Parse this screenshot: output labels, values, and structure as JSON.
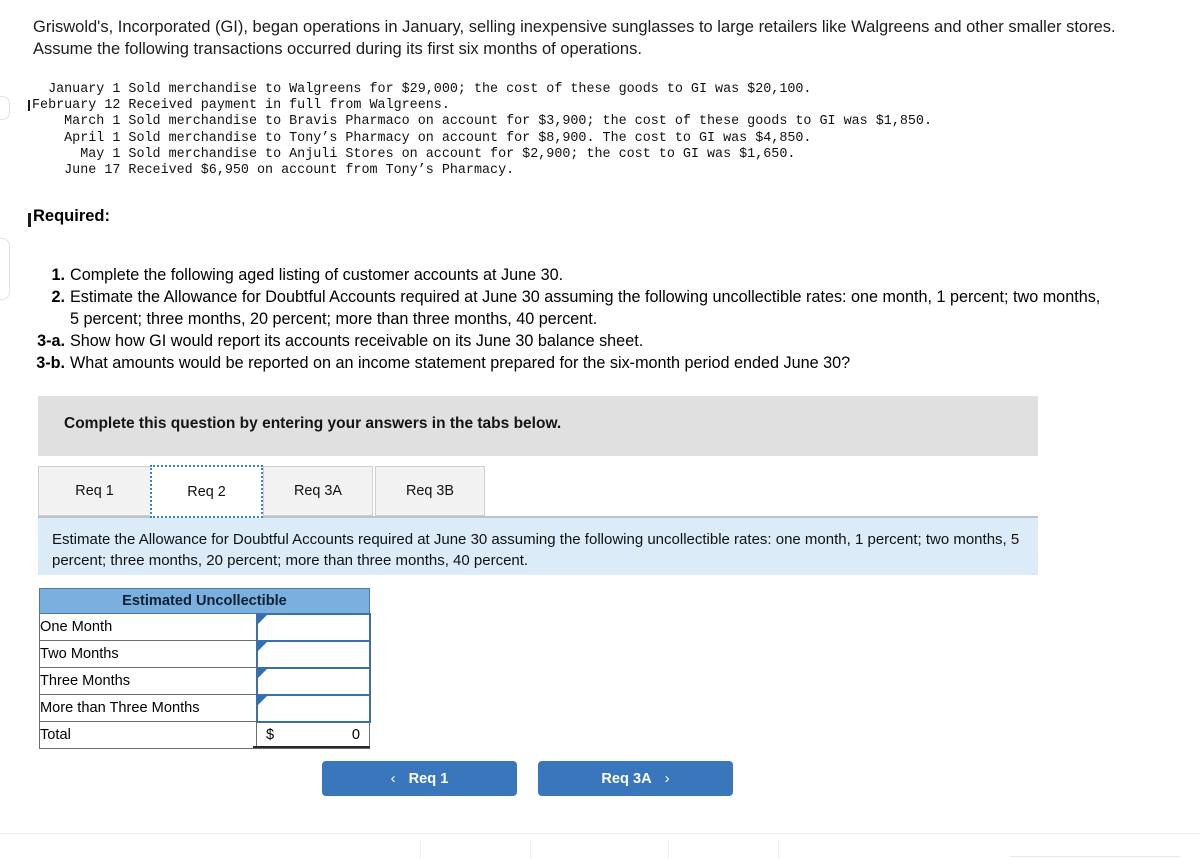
{
  "intro": {
    "paragraph": "Griswold's, Incorporated (GI), began operations in January, selling inexpensive sunglasses to large retailers like Walgreens and other smaller stores. Assume the following transactions occurred during its first six months of operations."
  },
  "transactions": {
    "block": "  January 1 Sold merchandise to Walgreens for $29,000; the cost of these goods to GI was $20,100.\nFebruary 12 Received payment in full from Walgreens.\n    March 1 Sold merchandise to Bravis Pharmaco on account for $3,900; the cost of these goods to GI was $1,850.\n    April 1 Sold merchandise to Tony’s Pharmacy on account for $8,900. The cost to GI was $4,850.\n      May 1 Sold merchandise to Anjuli Stores on account for $2,900; the cost to GI was $1,650.\n    June 17 Received $6,950 on account from Tony’s Pharmacy."
  },
  "required": {
    "heading": "Required:",
    "items": [
      {
        "num": "1.",
        "text": "Complete the following aged listing of customer accounts at June 30."
      },
      {
        "num": "2.",
        "text": "Estimate the Allowance for Doubtful Accounts required at June 30 assuming the following uncollectible rates: one month, 1 percent; two months, 5 percent; three months, 20 percent; more than three months, 40 percent."
      },
      {
        "num": "3-a.",
        "text": "Show how GI would report its accounts receivable on its June 30 balance sheet."
      },
      {
        "num": "3-b.",
        "text": "What amounts would be reported on an income statement prepared for the six-month period ended June 30?"
      }
    ]
  },
  "banner": {
    "text": "Complete this question by entering your answers in the tabs below."
  },
  "tabs": {
    "items": [
      {
        "label": "Req 1",
        "active": false
      },
      {
        "label": "Req 2",
        "active": true
      },
      {
        "label": "Req 3A",
        "active": false
      },
      {
        "label": "Req 3B",
        "active": false
      }
    ]
  },
  "instruction_panel": {
    "text": "Estimate the Allowance for Doubtful Accounts required at June 30 assuming the following uncollectible rates: one month, 1 percent; two months, 5 percent; three months, 20 percent; more than three months, 40 percent."
  },
  "answer_table": {
    "header": "Estimated Uncollectible",
    "rows": [
      {
        "label": "One Month",
        "value": ""
      },
      {
        "label": "Two Months",
        "value": ""
      },
      {
        "label": "Three Months",
        "value": ""
      },
      {
        "label": "More than Three Months",
        "value": ""
      }
    ],
    "total": {
      "label": "Total",
      "currency": "$",
      "amount": "0"
    }
  },
  "navigation": {
    "prev_label": "Req 1",
    "prev_icon": "chevron-left-icon",
    "prev_chevron": "‹",
    "next_label": "Req 3A",
    "next_icon": "chevron-right-icon",
    "next_chevron": "›"
  },
  "colors": {
    "table_header_blue": "#7bafdd",
    "panel_blue": "#dcebf8",
    "button_blue": "#3a76bb",
    "banner_grey": "#e0e0e0",
    "input_border_blue": "#3a6fa8",
    "active_tab_focus": "#3c82c4"
  }
}
